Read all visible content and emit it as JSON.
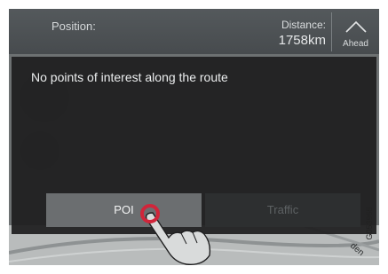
{
  "header": {
    "position_label": "Position:",
    "distance_label": "Distance:",
    "distance_value": "1758km",
    "ahead_label": "Ahead"
  },
  "panel": {
    "message": "No points of interest along the route"
  },
  "tabs": [
    {
      "label": "POI",
      "selected": true
    },
    {
      "label": "Traffic",
      "selected": false
    }
  ],
  "map": {
    "road_label": "den"
  },
  "figure_id": "G053965",
  "colors": {
    "touch_indicator": "#d0253a",
    "panel_bg": "#1e1e1f",
    "selected_tab": "#6b6e70"
  },
  "icons": {
    "ahead": "chevron-up-icon",
    "touch": "hand-pointer-icon"
  }
}
